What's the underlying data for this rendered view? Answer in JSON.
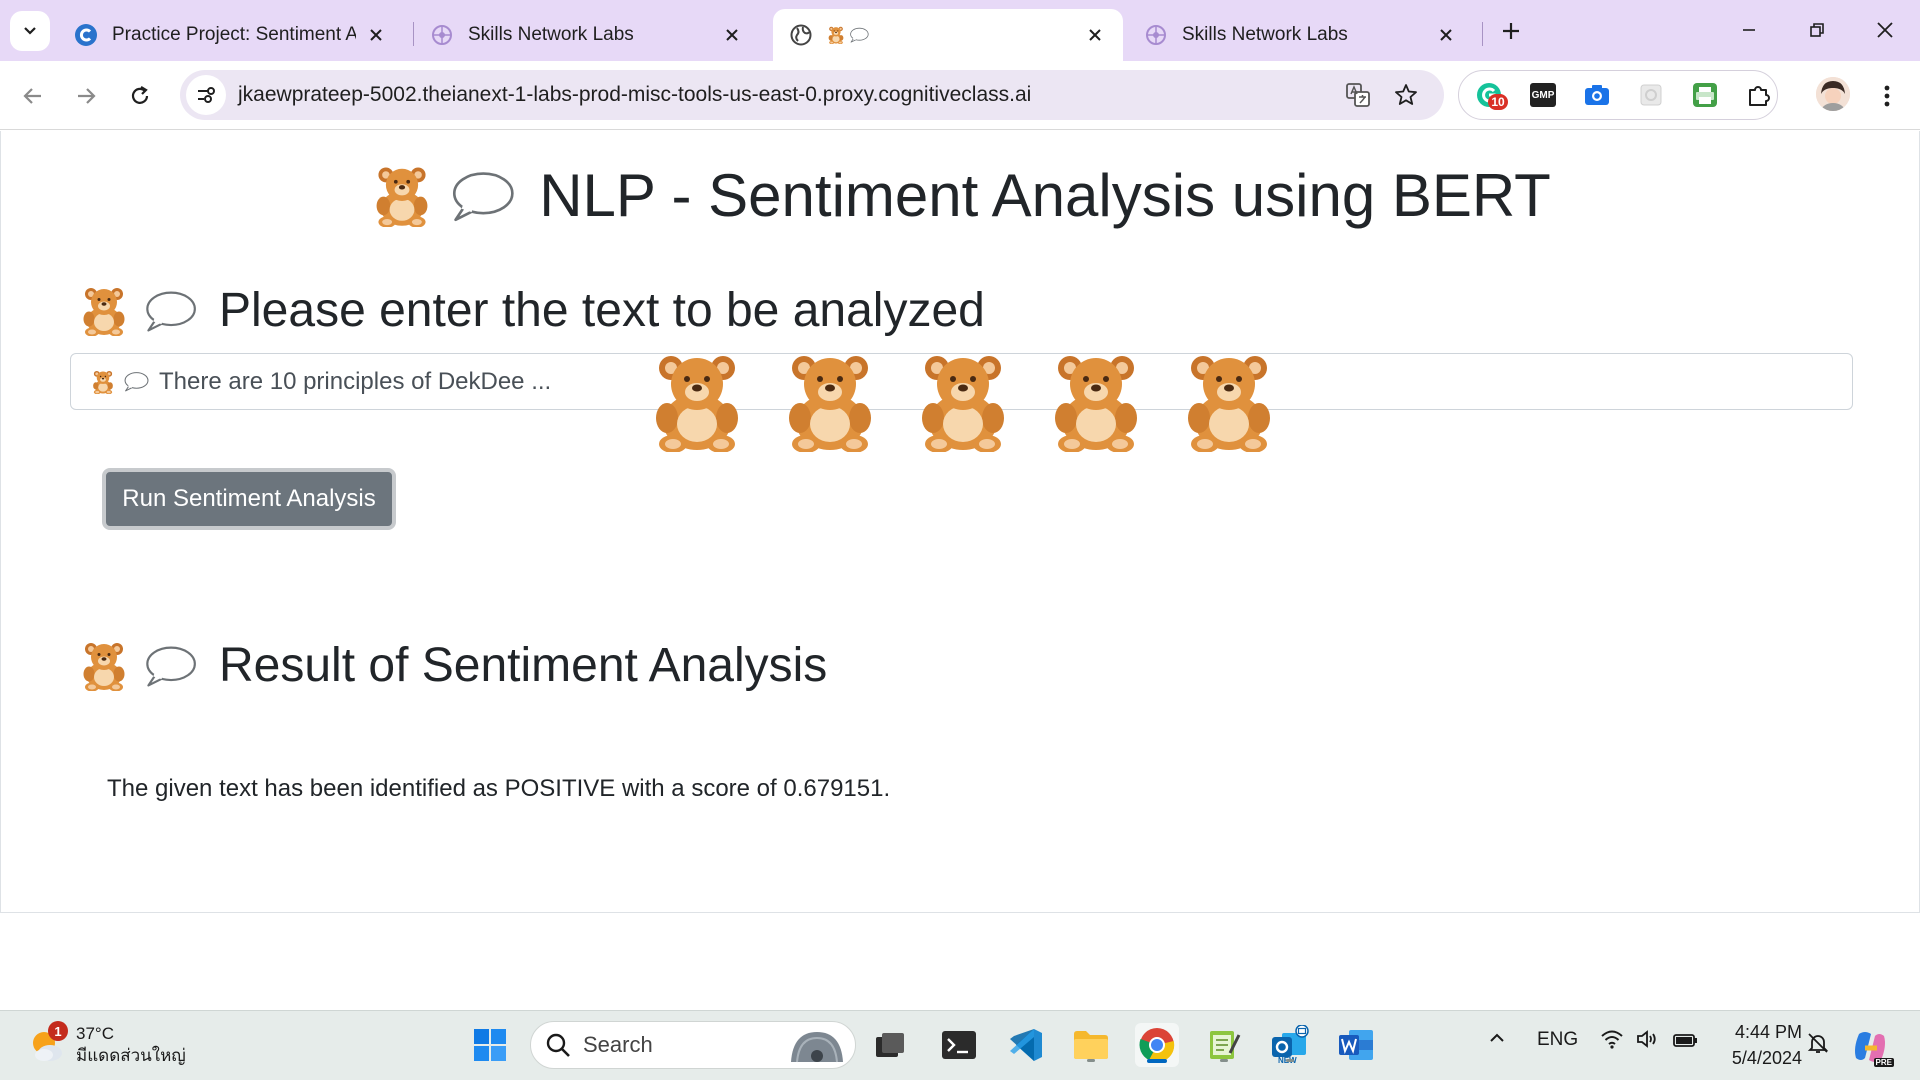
{
  "browser": {
    "tabs": [
      {
        "title": "Practice Project: Sentiment Anal",
        "favicon": "coursera-icon",
        "active": false
      },
      {
        "title": "Skills Network Labs",
        "favicon": "skills-network-icon",
        "active": false
      },
      {
        "title": "",
        "favicon": "globe-icon",
        "emoji_favicon": "teddy-bear-speech-icon",
        "active": true
      },
      {
        "title": "Skills Network Labs",
        "favicon": "skills-network-icon",
        "active": false
      }
    ],
    "url": "jkaewprateep-5002.theianext-1-labs-prod-misc-tools-us-east-0.proxy.cognitiveclass.ai",
    "extension_badge": "10",
    "extensions": [
      "grammarly-icon",
      "gmp-icon",
      "camera-icon",
      "blank-extension-icon",
      "printer-icon",
      "puzzle-icon"
    ],
    "gmp_label": "GMP"
  },
  "page": {
    "title": "NLP - Sentiment Analysis using BERT",
    "input_heading": "Please enter the text to be analyzed",
    "input_value": "There are 10 principles of DekDee ...",
    "bear_count": 5,
    "run_button_label": "Run Sentiment Analysis",
    "result_heading": "Result of Sentiment Analysis",
    "result_text": "The given text has been identified as POSITIVE with a score of 0.679151."
  },
  "taskbar": {
    "weather_temp": "37°C",
    "weather_desc": "มีแดดส่วนใหญ่",
    "weather_badge": "1",
    "search_label": "Search",
    "language": "ENG",
    "time": "4:44 PM",
    "date": "5/4/2024",
    "copilot_label": "PRE",
    "outlook_label": "NEW"
  },
  "colors": {
    "tabstrip": "#e7d9f7",
    "omnibox": "#ece6f3",
    "run_button": "#6c757d",
    "taskbar": "#e6ecea",
    "bear": "#e0913d"
  }
}
